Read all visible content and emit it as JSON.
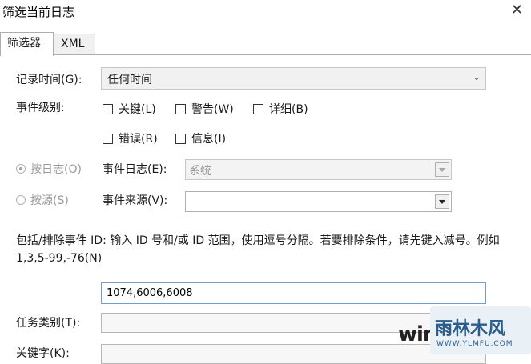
{
  "window": {
    "title": "筛选当前日志",
    "close_glyph": "✕"
  },
  "tabs": [
    {
      "label": "筛选器",
      "active": true
    },
    {
      "label": "XML",
      "active": false
    }
  ],
  "logged": {
    "label": "记录时间(G):",
    "value": "任何时间",
    "chevron": "⌄"
  },
  "event_level": {
    "label": "事件级别:",
    "options": [
      {
        "label": "关键(L)",
        "checked": false
      },
      {
        "label": "警告(W)",
        "checked": false
      },
      {
        "label": "详细(B)",
        "checked": false
      },
      {
        "label": "错误(R)",
        "checked": false
      },
      {
        "label": "信息(I)",
        "checked": false
      }
    ]
  },
  "by_log": {
    "radio_label": "按日志(O)",
    "selected": true,
    "field_label": "事件日志(E):",
    "value": "系统"
  },
  "by_source": {
    "radio_label": "按源(S)",
    "selected": false,
    "field_label": "事件来源(V):",
    "value": ""
  },
  "event_ids": {
    "description": "包括/排除事件 ID: 输入 ID 号和/或 ID 范围，使用逗号分隔。若要排除条件，请先键入减号。例如 1,3,5-99,-76(N)",
    "value": "1074,6006,6008"
  },
  "task_category": {
    "label": "任务类别(T):",
    "value": ""
  },
  "keywords": {
    "label": "关键字(K):",
    "value": ""
  },
  "watermark": {
    "left_text": "win",
    "brand_text": "雨林木风",
    "url_text": "WWW.YLMFU.COM"
  }
}
